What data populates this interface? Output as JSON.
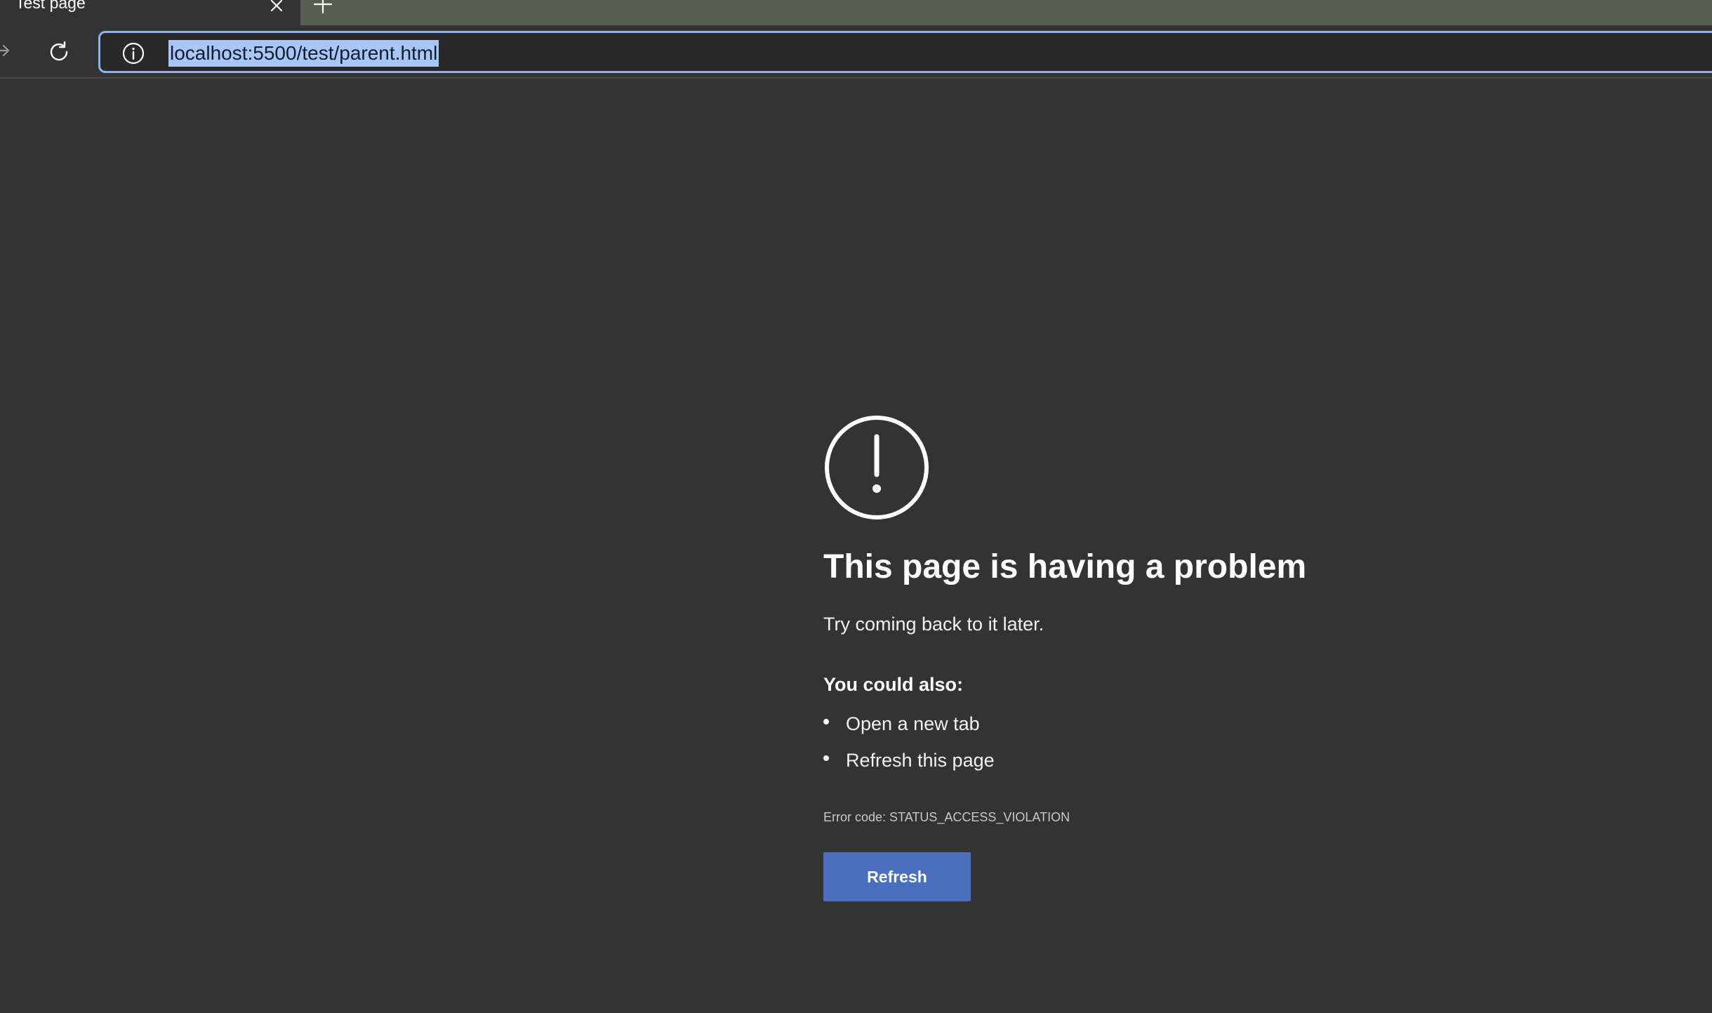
{
  "browser": {
    "tab": {
      "title": "Test page"
    },
    "address_bar": {
      "url": "localhost:5500/test/parent.html"
    }
  },
  "error_page": {
    "icon": "exclamation-circle-icon",
    "title": "This page is having a problem",
    "subtitle": "Try coming back to it later.",
    "suggestions_heading": "You could also:",
    "suggestions": [
      "Open a new tab",
      "Refresh this page"
    ],
    "error_code": "Error code: STATUS_ACCESS_VIOLATION",
    "refresh_label": "Refresh"
  },
  "colors": {
    "page_background": "#333333",
    "tabstrip_background": "#555e51",
    "address_focus_border": "#8cb4f0",
    "url_selection": "#a9c6f4",
    "button_primary": "#4a6fbf"
  }
}
